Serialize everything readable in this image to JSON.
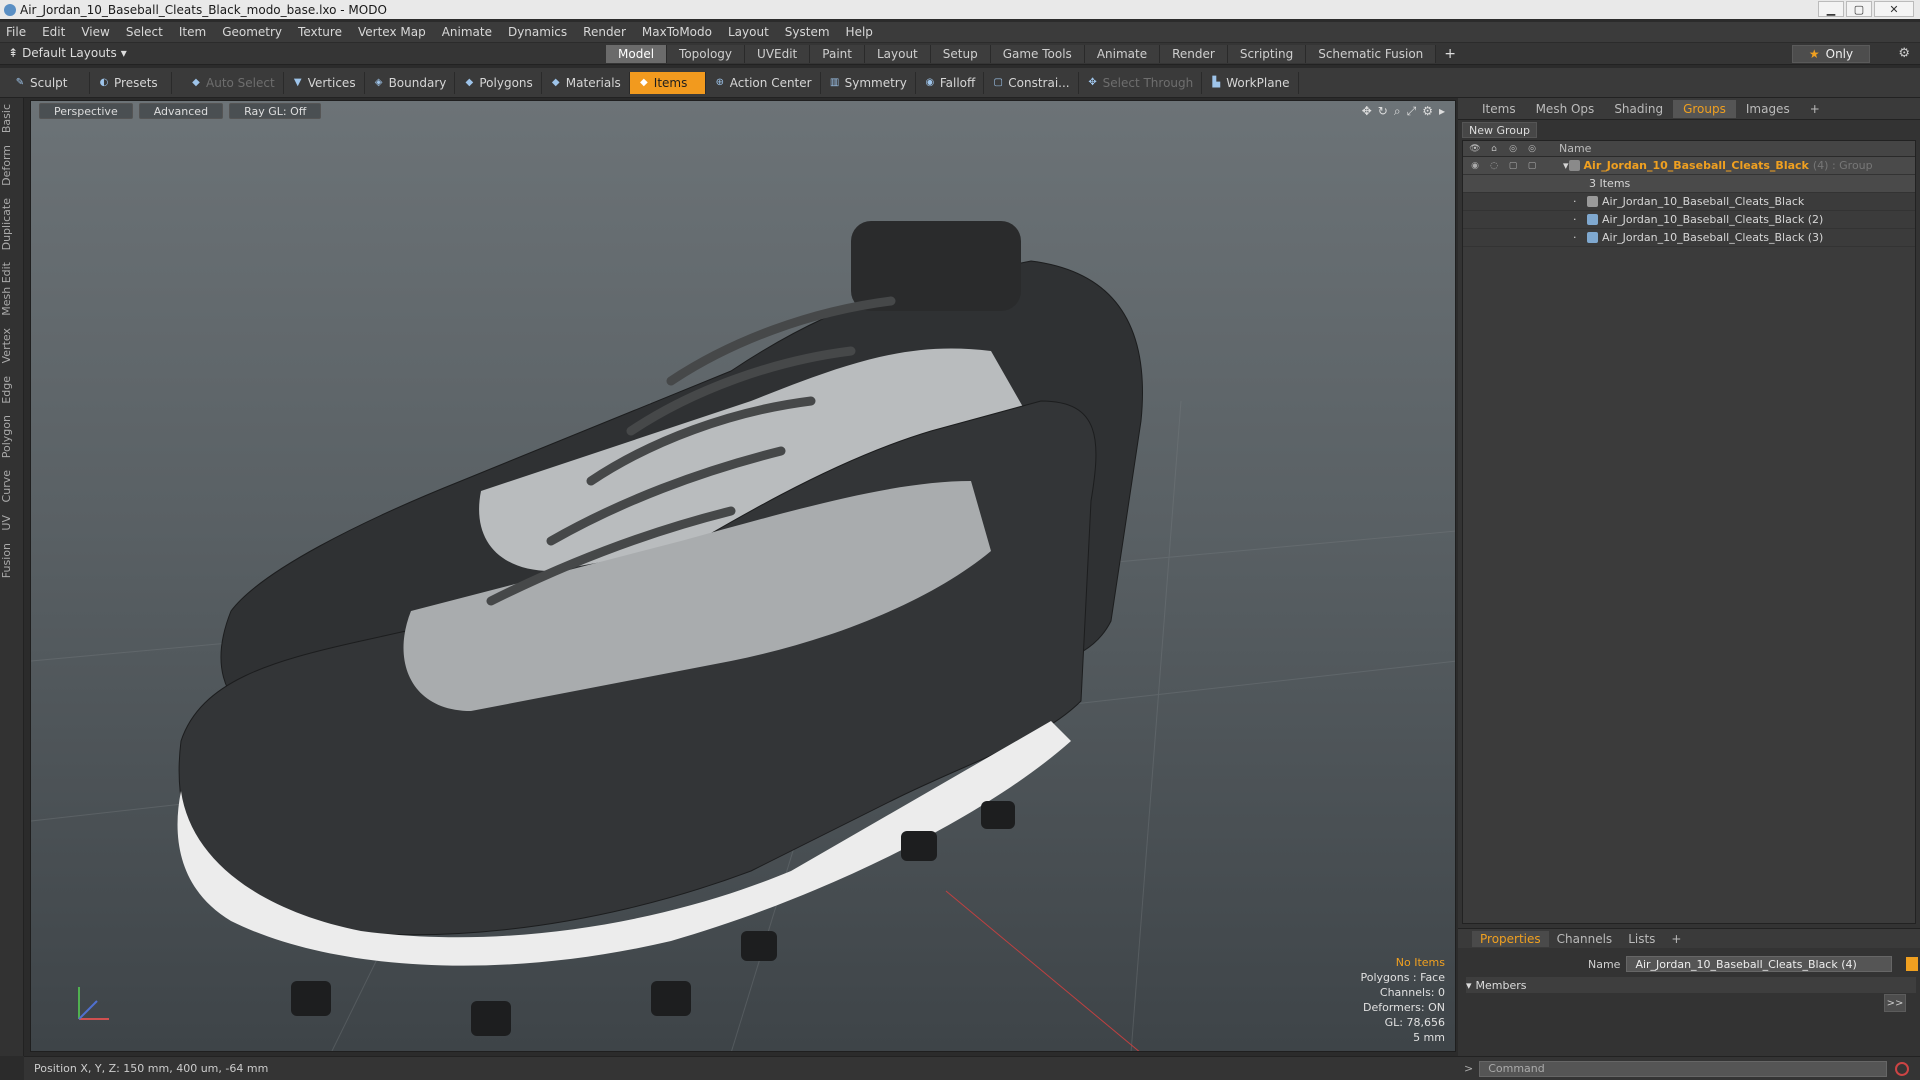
{
  "window": {
    "title": "Air_Jordan_10_Baseball_Cleats_Black_modo_base.lxo - MODO"
  },
  "menu": [
    "File",
    "Edit",
    "View",
    "Select",
    "Item",
    "Geometry",
    "Texture",
    "Vertex Map",
    "Animate",
    "Dynamics",
    "Render",
    "MaxToModo",
    "Layout",
    "System",
    "Help"
  ],
  "layouts": {
    "default_label": "Default Layouts",
    "tabs": [
      "Model",
      "Topology",
      "UVEdit",
      "Paint",
      "Layout",
      "Setup",
      "Game Tools",
      "Animate",
      "Render",
      "Scripting",
      "Schematic Fusion"
    ],
    "active": "Model",
    "only_label": "Only"
  },
  "toolbar": {
    "sculpt": "Sculpt",
    "presets": "Presets",
    "auto_select": "Auto Select",
    "vertices": "Vertices",
    "boundary": "Boundary",
    "polygons": "Polygons",
    "materials": "Materials",
    "items": "Items",
    "action_center": "Action Center",
    "symmetry": "Symmetry",
    "falloff": "Falloff",
    "constrain": "Constrai...",
    "select_through": "Select Through",
    "workplane": "WorkPlane"
  },
  "left_tabs": [
    "Basic",
    "Deform",
    "Duplicate",
    "Mesh Edit",
    "Vertex",
    "Edge",
    "Polygon",
    "Curve",
    "UV",
    "Fusion"
  ],
  "viewport": {
    "perspective": "Perspective",
    "advanced": "Advanced",
    "raygl": "Ray GL: Off",
    "info": {
      "no_items": "No Items",
      "polygons": "Polygons : Face",
      "channels": "Channels: 0",
      "deformers": "Deformers: ON",
      "gl": "GL: 78,656",
      "unit": "5 mm"
    }
  },
  "right_panel": {
    "tabs": [
      "Items",
      "Mesh Ops",
      "Shading",
      "Groups",
      "Images"
    ],
    "active_tab": "Groups",
    "new_group": "New Group",
    "col_name": "Name",
    "group": {
      "name": "Air_Jordan_10_Baseball_Cleats_Black",
      "suffix": "(4) : Group",
      "count": "3 Items"
    },
    "children": [
      "Air_Jordan_10_Baseball_Cleats_Black",
      "Air_Jordan_10_Baseball_Cleats_Black (2)",
      "Air_Jordan_10_Baseball_Cleats_Black (3)"
    ]
  },
  "properties": {
    "tabs": [
      "Properties",
      "Channels",
      "Lists"
    ],
    "name_label": "Name",
    "name_value": "Air_Jordan_10_Baseball_Cleats_Black (4)",
    "members": "Members"
  },
  "status": {
    "position": "Position X, Y, Z:  150 mm, 400 um, -64 mm"
  },
  "command": {
    "placeholder": "Command"
  },
  "colors": {
    "accent": "#f29a1e",
    "panel": "#333333",
    "viewport_top": "#6c7377"
  }
}
